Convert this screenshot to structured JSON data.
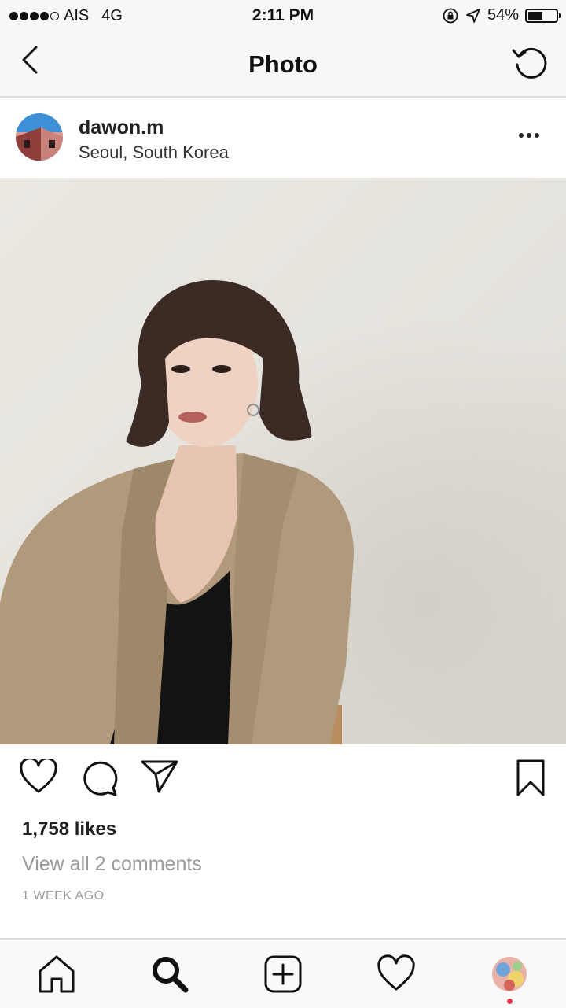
{
  "status_bar": {
    "carrier": "AIS",
    "network": "4G",
    "time": "2:11 PM",
    "battery_percent": "54%",
    "battery_level": 0.54,
    "signal_bars_filled": 4,
    "signal_bars_total": 5
  },
  "nav": {
    "title": "Photo",
    "back_icon": "chevron-left-icon",
    "refresh_icon": "refresh-icon"
  },
  "post": {
    "username": "dawon.m",
    "location": "Seoul, South Korea",
    "likes": "1,758 likes",
    "comments_link": "View all 2 comments",
    "timestamp": "1 WEEK AGO"
  },
  "actions": {
    "like_icon": "heart-icon",
    "comment_icon": "comment-icon",
    "share_icon": "direct-send-icon",
    "save_icon": "bookmark-icon"
  },
  "tab_bar": {
    "items": [
      "home-icon",
      "search-icon",
      "add-post-icon",
      "activity-heart-icon",
      "profile-avatar"
    ],
    "notification_color": "#e8334a"
  }
}
